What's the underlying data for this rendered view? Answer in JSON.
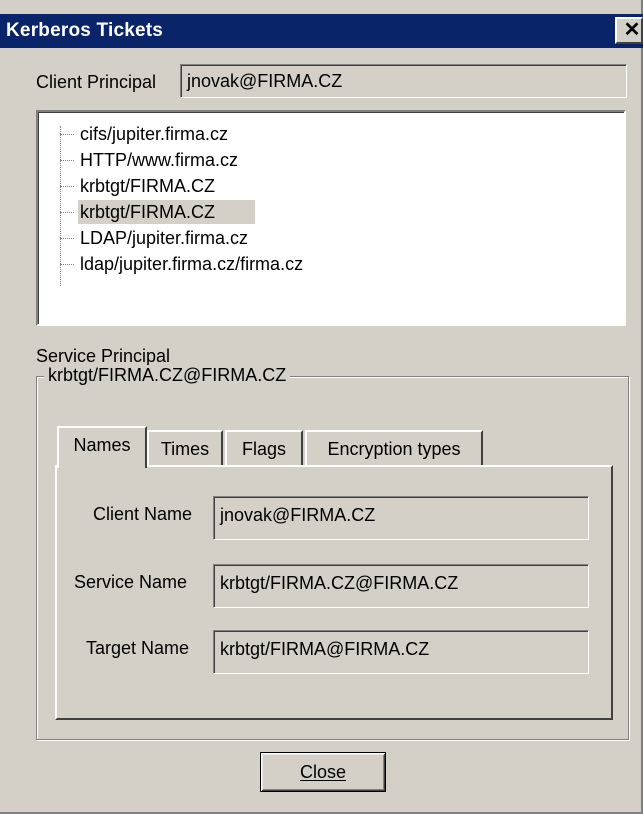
{
  "window": {
    "title": "Kerberos Tickets",
    "close_glyph": "✕"
  },
  "client_principal": {
    "label": "Client Principal",
    "value": "jnovak@FIRMA.CZ"
  },
  "tickets": [
    {
      "label": "cifs/jupiter.firma.cz",
      "selected": false
    },
    {
      "label": "HTTP/www.firma.cz",
      "selected": false
    },
    {
      "label": "krbtgt/FIRMA.CZ",
      "selected": false
    },
    {
      "label": "krbtgt/FIRMA.CZ",
      "selected": true
    },
    {
      "label": "LDAP/jupiter.firma.cz",
      "selected": false
    },
    {
      "label": "ldap/jupiter.firma.cz/firma.cz",
      "selected": false
    }
  ],
  "service_principal": {
    "label": "Service Principal",
    "group_title": "krbtgt/FIRMA.CZ@FIRMA.CZ"
  },
  "tabs": [
    {
      "label": "Names",
      "active": true
    },
    {
      "label": "Times",
      "active": false
    },
    {
      "label": "Flags",
      "active": false
    },
    {
      "label": "Encryption types",
      "active": false
    }
  ],
  "names": {
    "client_name_label": "Client Name",
    "client_name_value": "jnovak@FIRMA.CZ",
    "service_name_label": "Service Name",
    "service_name_value": "krbtgt/FIRMA.CZ@FIRMA.CZ",
    "target_name_label": "Target Name",
    "target_name_value": "krbtgt/FIRMA@FIRMA.CZ"
  },
  "buttons": {
    "close_label": "Close"
  },
  "colors": {
    "titlebar": "#0a246a",
    "face": "#d4d0c8",
    "selection": "#d4d0c8"
  }
}
